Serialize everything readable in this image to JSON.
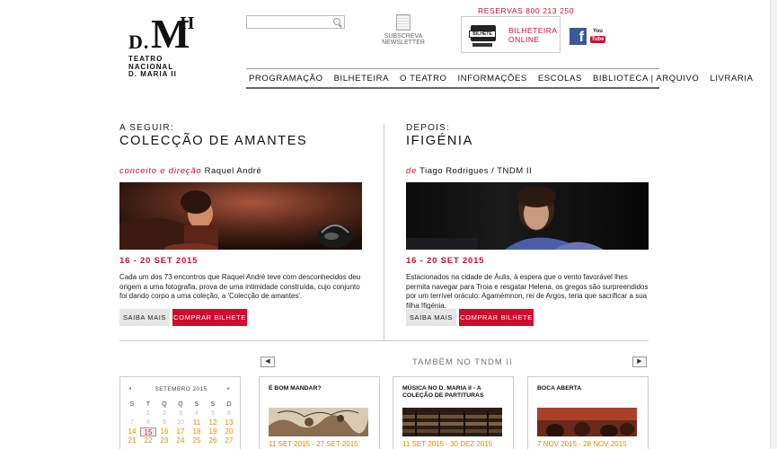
{
  "header": {
    "logo": {
      "d": "D.",
      "m": "M",
      "ii": "II",
      "line1": "TEATRO",
      "line2": "NACIONAL",
      "line3": "D. MARIA II"
    },
    "search_placeholder": "",
    "newsletter": {
      "line1": "SUBSCREVA",
      "line2": "NEWSLETTER"
    },
    "reservas": "RESERVAS 800 213 250",
    "bilheteira": {
      "line1": "BILHETEIRA",
      "line2": "ONLINE",
      "ticket_text": "BILHETE"
    },
    "facebook": "f",
    "youtube": {
      "line1": "You",
      "line2": "Tube"
    }
  },
  "menu": [
    "PROGRAMAÇÃO",
    "BILHETEIRA",
    "O TEATRO",
    "INFORMAÇÕES",
    "ESCOLAS",
    "BIBLIOTECA | ARQUIVO",
    "LIVRARIA"
  ],
  "left": {
    "label": "A SEGUIR:",
    "title": "COLECÇÃO DE AMANTES",
    "credit_prefix": "conceito e direção",
    "credit_name": "Raquel André",
    "date": "16 - 20 SET 2015",
    "description": "Cada um dos 73 encontros que Raquel André teve com desconhecidos deu origem a uma fotografia, prova de uma intimidade construída, cujo conjunto foi dando corpo a uma coleção, a 'Colecção de amantes'.",
    "more_label": "SAIBA MAIS",
    "buy_label": "COMPRAR BILHETE"
  },
  "right": {
    "label": "DEPOIS:",
    "title": "IFIGÉNIA",
    "credit_prefix": "de",
    "credit_name": "Tiago Rodrigues / TNDM II",
    "date": "16 - 20 SET 2015",
    "description": "Estacionados na cidade de Áulis, à espera que o vento favorável lhes permita navegar para Troia e resgatar Helena, os gregos são surpreendidos por um terrível oráculo: Agamémnon, rei de Argos, teria que sacrificar a sua filha Ifigénia.",
    "more_label": "SAIBA MAIS",
    "buy_label": "COMPRAR BILHETE"
  },
  "also": {
    "heading": "TAMBÉM NO TNDM II",
    "prev": "◀",
    "next": "▶"
  },
  "calendar": {
    "month": "SETEMBRO 2015",
    "prev": "◂",
    "next": "▸",
    "weekdays": [
      "S",
      "T",
      "Q",
      "Q",
      "S",
      "S",
      "D"
    ],
    "rows": [
      [
        "",
        "1",
        "2",
        "3",
        "4",
        "5",
        "6"
      ],
      [
        "7",
        "8",
        "9",
        "10",
        "11",
        "12",
        "13"
      ],
      [
        "14",
        "15",
        "16",
        "17",
        "18",
        "19",
        "20"
      ],
      [
        "21",
        "22",
        "23",
        "24",
        "25",
        "26",
        "27"
      ]
    ],
    "selected": "15"
  },
  "cards": [
    {
      "title": "É BOM MANDAR?",
      "date": "11 SET 2015 - 27 SET 2015"
    },
    {
      "title": "MÚSICA NO D. MARIA II - A COLEÇÃO DE PARTITURAS",
      "date": "11 SET 2015 - 30 DEZ 2015"
    },
    {
      "title": "BOCA ABERTA",
      "date": "7 NOV 2015 - 28 NOV 2015"
    }
  ],
  "colors": {
    "accent_red": "#c8102e",
    "orange": "#e28a00"
  }
}
